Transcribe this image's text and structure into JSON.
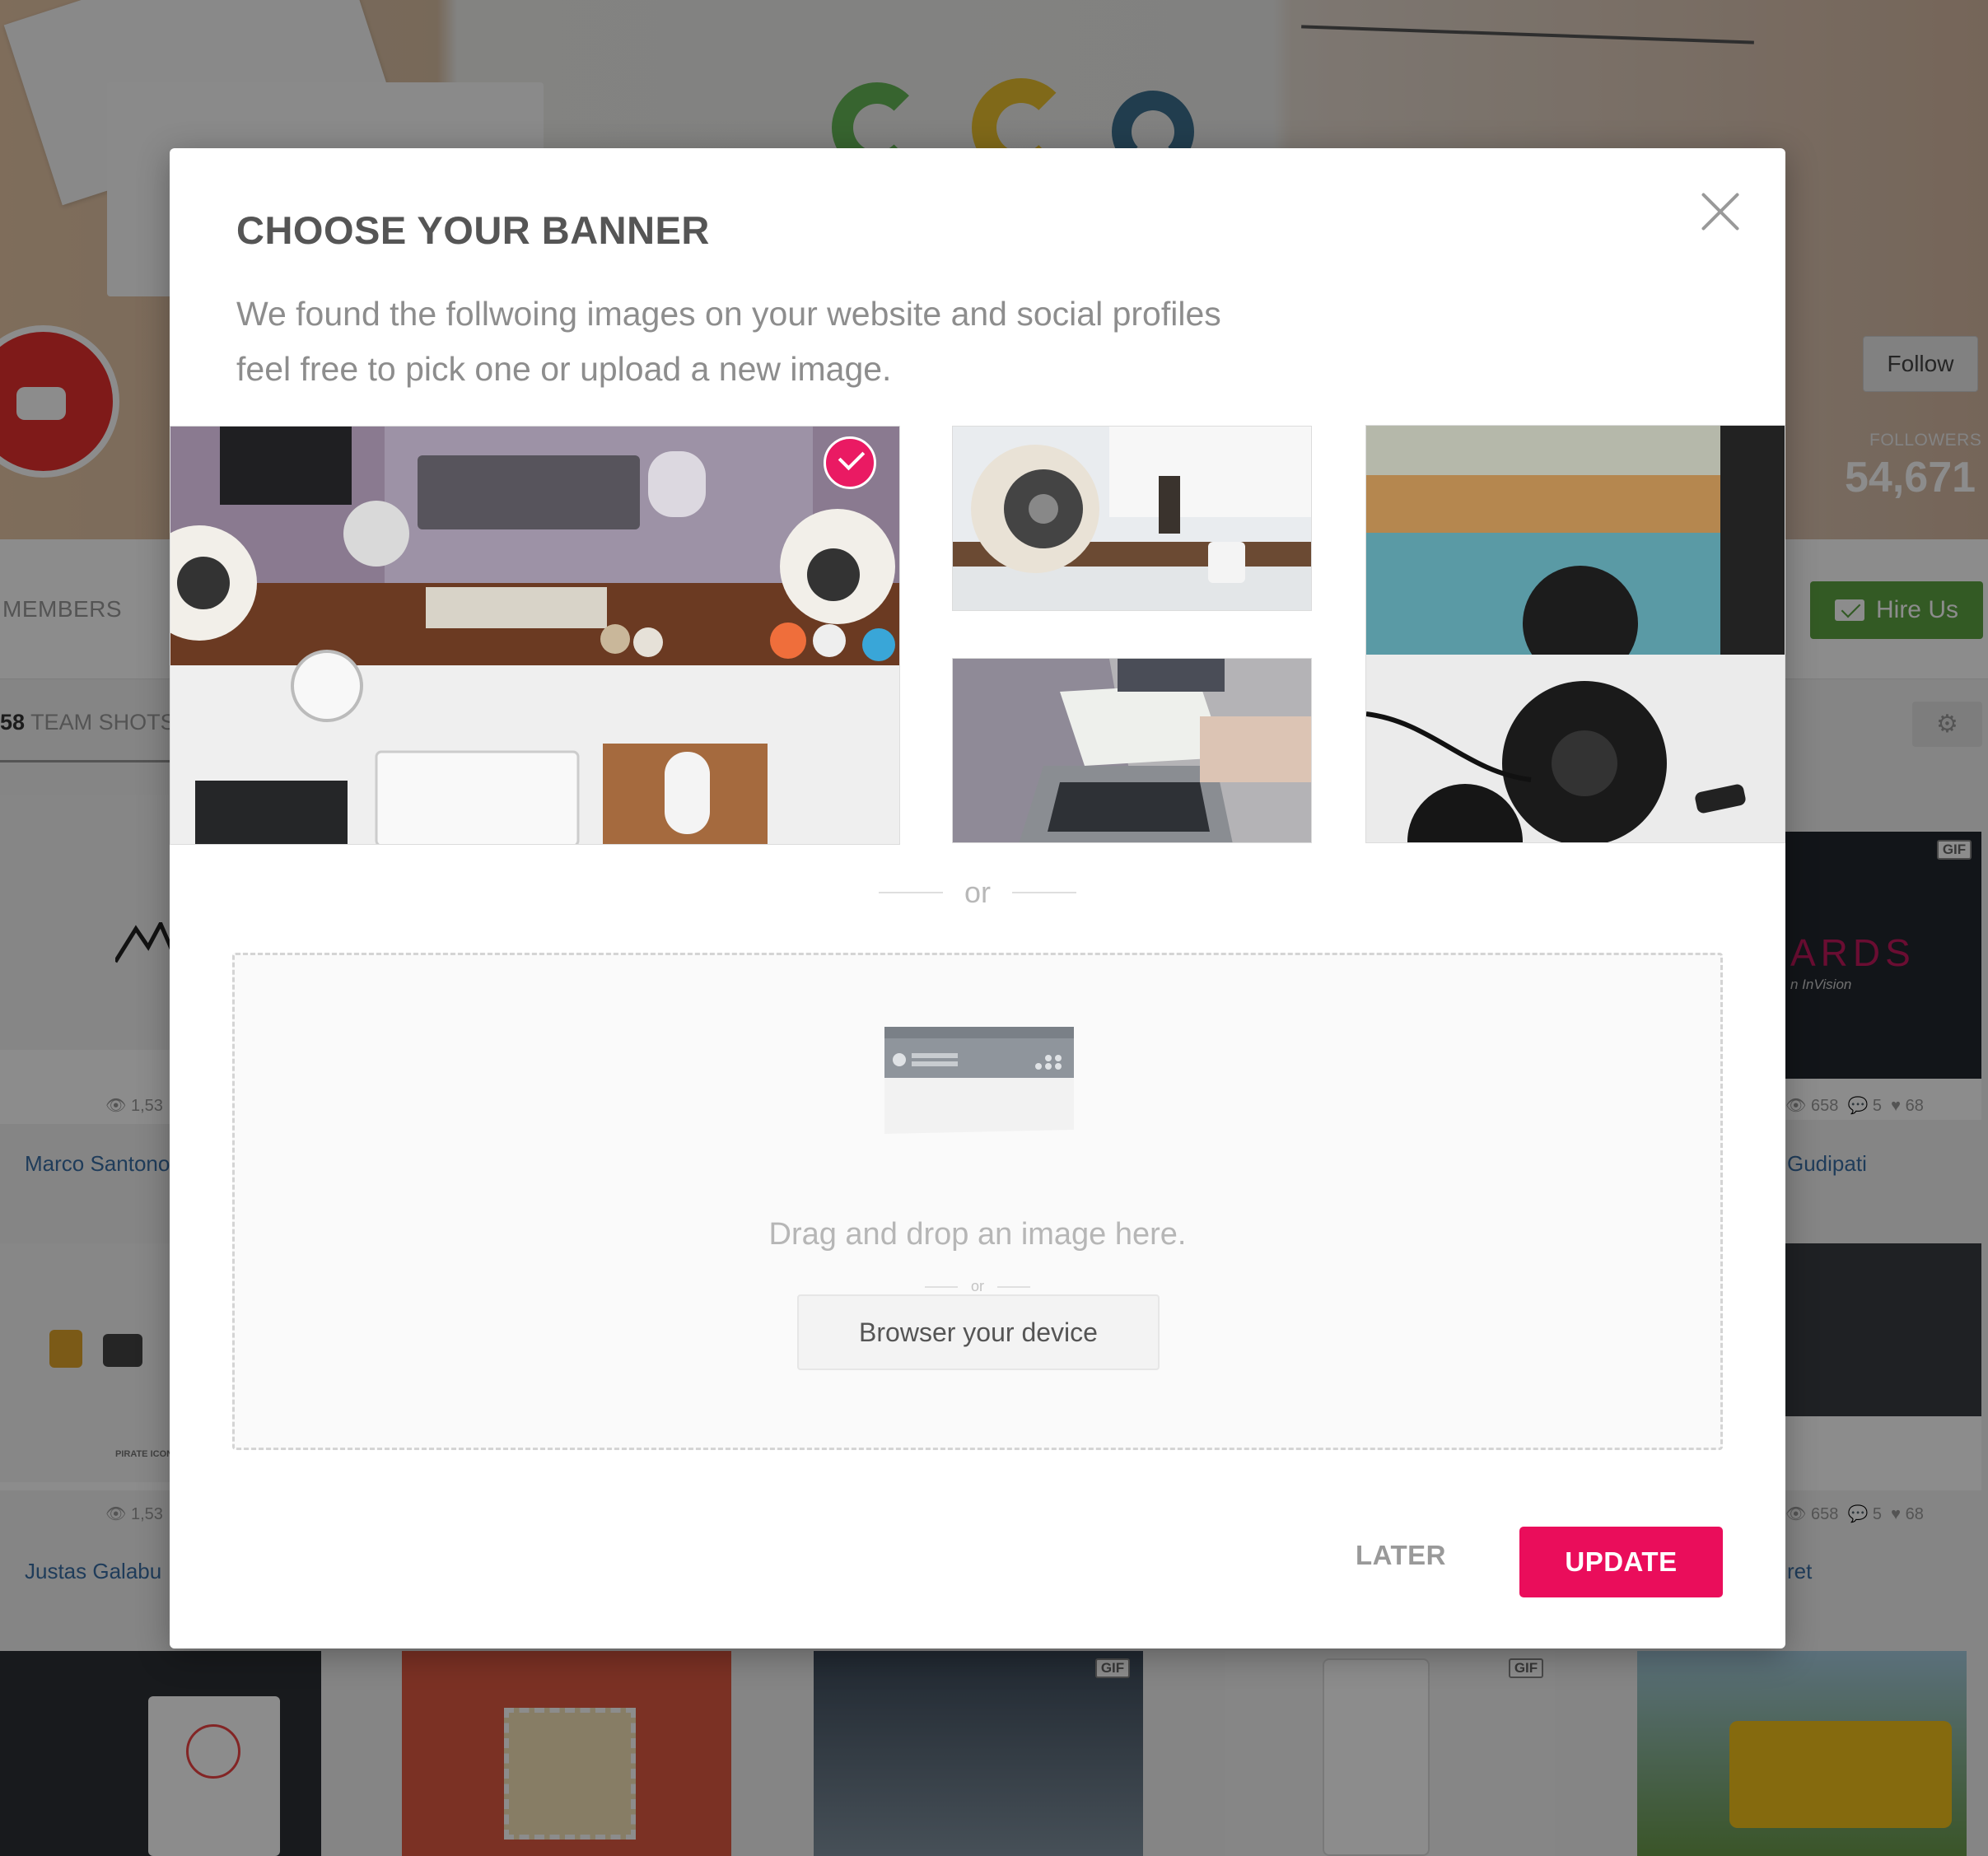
{
  "background": {
    "follow_label": "Follow",
    "followers_label": "FOLLOWERS",
    "followers_count": "54,671",
    "nav_members": "MEMBERS",
    "hire_label": "Hire Us",
    "team_shots_count": "58",
    "team_shots_label": "TEAM SHOTS",
    "gif_badge": "GIF",
    "shots": [
      {
        "views": "1,53",
        "author": "Marco Santono"
      },
      {
        "views": "658",
        "comments": "5",
        "likes": "68",
        "author": "Gudipati"
      },
      {
        "views": "1,53",
        "author": "Justas Galabu"
      },
      {
        "views": "658",
        "comments": "5",
        "likes": "68",
        "author": "ret"
      }
    ],
    "cards_text": "ARDS",
    "cards_sub": "n InVision",
    "pirate_text": "PIRATE ICON"
  },
  "modal": {
    "title": "CHOOSE YOUR BANNER",
    "description": "We found the follwoing images on your website and social profiles feel free to pick one or upload a new image.",
    "images": [
      {
        "name": "desk-top-view",
        "selected": true
      },
      {
        "name": "speaker-desk",
        "selected": false
      },
      {
        "name": "laptop-sketching",
        "selected": false
      },
      {
        "name": "headphones-sea",
        "selected": false
      }
    ],
    "or_label": "or",
    "dropzone": {
      "text": "Drag and drop an image here.",
      "or_label": "or",
      "browse_label": "Browser your device"
    },
    "later_label": "LATER",
    "update_label": "UPDATE"
  },
  "colors": {
    "accent": "#ea0d5b",
    "hire_green": "#5da543",
    "title_gray": "#555555"
  }
}
